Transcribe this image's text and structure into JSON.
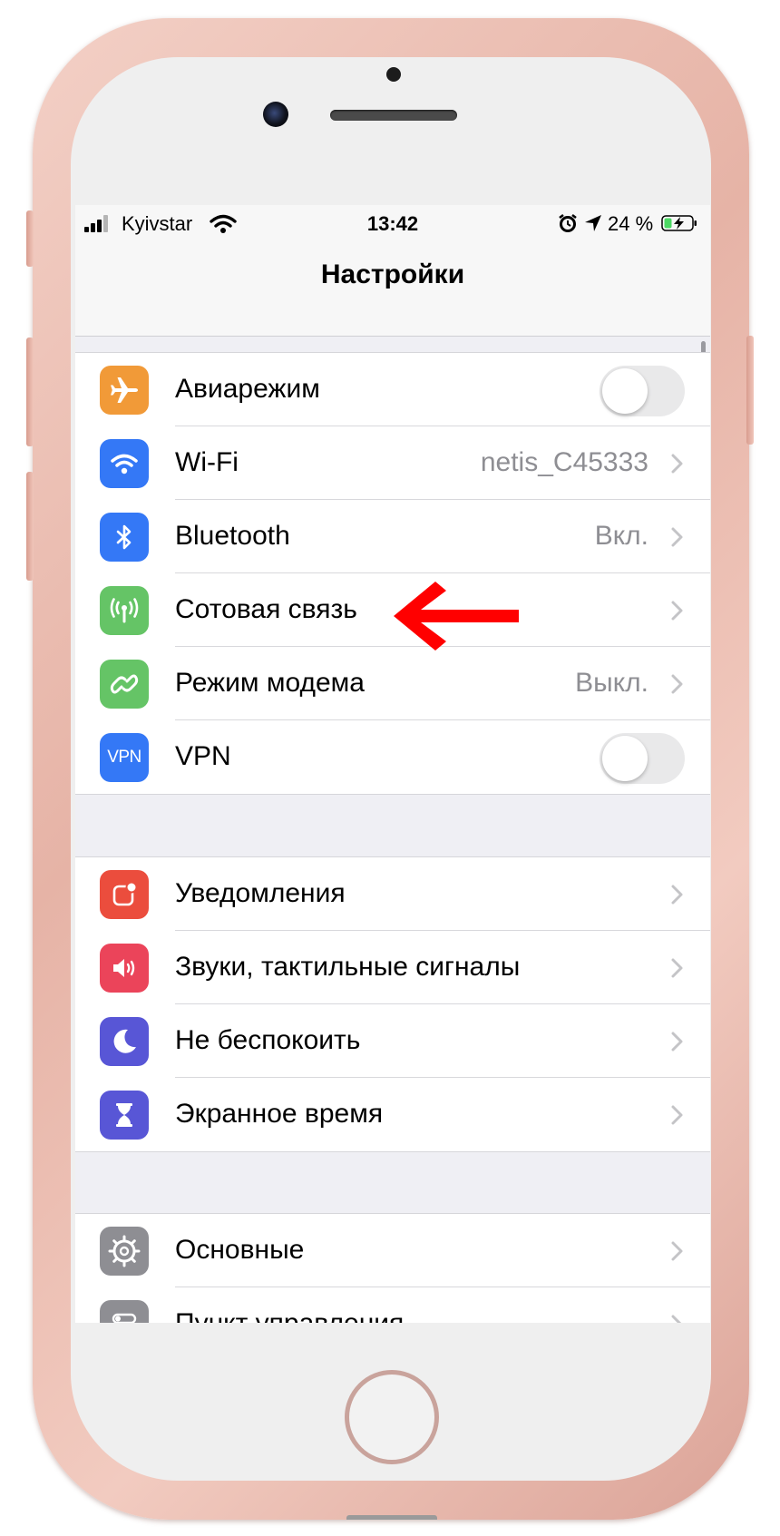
{
  "status_bar": {
    "carrier": "Kyivstar",
    "time": "13:42",
    "battery_percent": "24 %",
    "icons": [
      "signal-icon",
      "wifi-icon",
      "alarm-icon",
      "location-arrow-icon",
      "battery-charging-icon"
    ]
  },
  "nav": {
    "title": "Настройки"
  },
  "groups": [
    {
      "rows": [
        {
          "label": "Авиарежим",
          "icon": "airplane-icon",
          "color": "#f19a38",
          "accessory": "toggle",
          "toggle_on": false
        },
        {
          "label": "Wi-Fi",
          "icon": "wifi-icon",
          "color": "#3478f6",
          "value": "netis_C45333",
          "accessory": "chevron"
        },
        {
          "label": "Bluetooth",
          "icon": "bluetooth-icon",
          "color": "#3478f6",
          "value": "Вкл.",
          "accessory": "chevron"
        },
        {
          "label": "Сотовая связь",
          "icon": "antenna-icon",
          "color": "#65c466",
          "accessory": "chevron"
        },
        {
          "label": "Режим модема",
          "icon": "link-chain-icon",
          "color": "#65c466",
          "value": "Выкл.",
          "accessory": "chevron"
        },
        {
          "label": "VPN",
          "icon": "vpn-icon",
          "icon_text": "VPN",
          "color": "#3478f6",
          "accessory": "toggle",
          "toggle_on": false
        }
      ]
    },
    {
      "rows": [
        {
          "label": "Уведомления",
          "icon": "notifications-icon",
          "color": "#eb4d3d",
          "accessory": "chevron"
        },
        {
          "label": "Звуки, тактильные сигналы",
          "icon": "speaker-icon",
          "color": "#eb445a",
          "accessory": "chevron"
        },
        {
          "label": "Не беспокоить",
          "icon": "moon-icon",
          "color": "#5856d6",
          "accessory": "chevron"
        },
        {
          "label": "Экранное время",
          "icon": "hourglass-icon",
          "color": "#5856d6",
          "accessory": "chevron"
        }
      ]
    },
    {
      "rows": [
        {
          "label": "Основные",
          "icon": "gear-icon",
          "color": "#8e8e93",
          "accessory": "chevron"
        },
        {
          "label": "Пункт управления",
          "icon": "switches-icon",
          "color": "#8e8e93",
          "accessory": "chevron"
        }
      ]
    }
  ],
  "colors": {
    "annotation_arrow": "#ff0000",
    "phone_frame": "#e8b8ab"
  }
}
